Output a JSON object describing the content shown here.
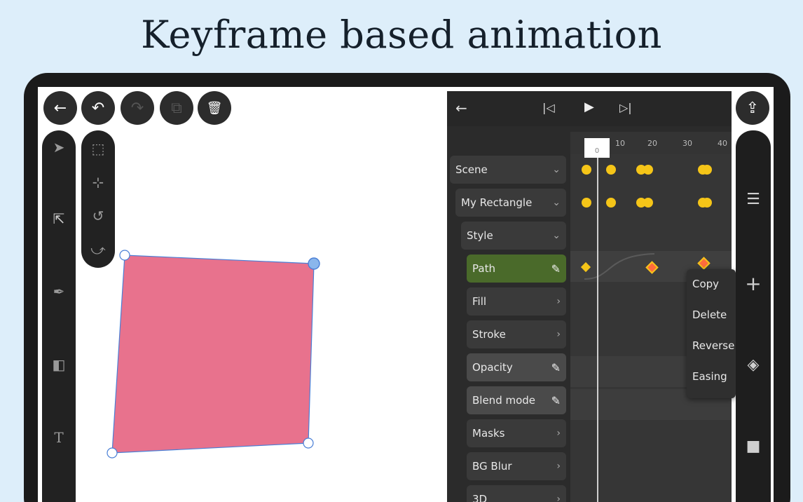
{
  "headline": "Keyframe based animation",
  "toolbar": {
    "back": "←",
    "undo": "↶",
    "redo": "↷",
    "duplicate": "⧉",
    "delete": "🗑"
  },
  "timeline": {
    "ruler_ticks": [
      "10",
      "20",
      "30",
      "40"
    ],
    "current_frame": "0",
    "layers": [
      {
        "label": "Scene"
      },
      {
        "label": "My Rectangle"
      },
      {
        "label": "Style"
      },
      {
        "label": "Path"
      },
      {
        "label": "Fill"
      },
      {
        "label": "Stroke"
      },
      {
        "label": "Opacity"
      },
      {
        "label": "Blend mode"
      },
      {
        "label": "Masks"
      },
      {
        "label": "BG Blur"
      },
      {
        "label": "3D"
      }
    ]
  },
  "context_menu": {
    "items": [
      "Copy",
      "Delete",
      "Reverse",
      "Easing"
    ]
  },
  "colors": {
    "shape_fill": "#e8728d",
    "selection_stroke": "#4a7fd6",
    "keyframe": "#f5c518",
    "path_row": "#4a6a2a"
  }
}
